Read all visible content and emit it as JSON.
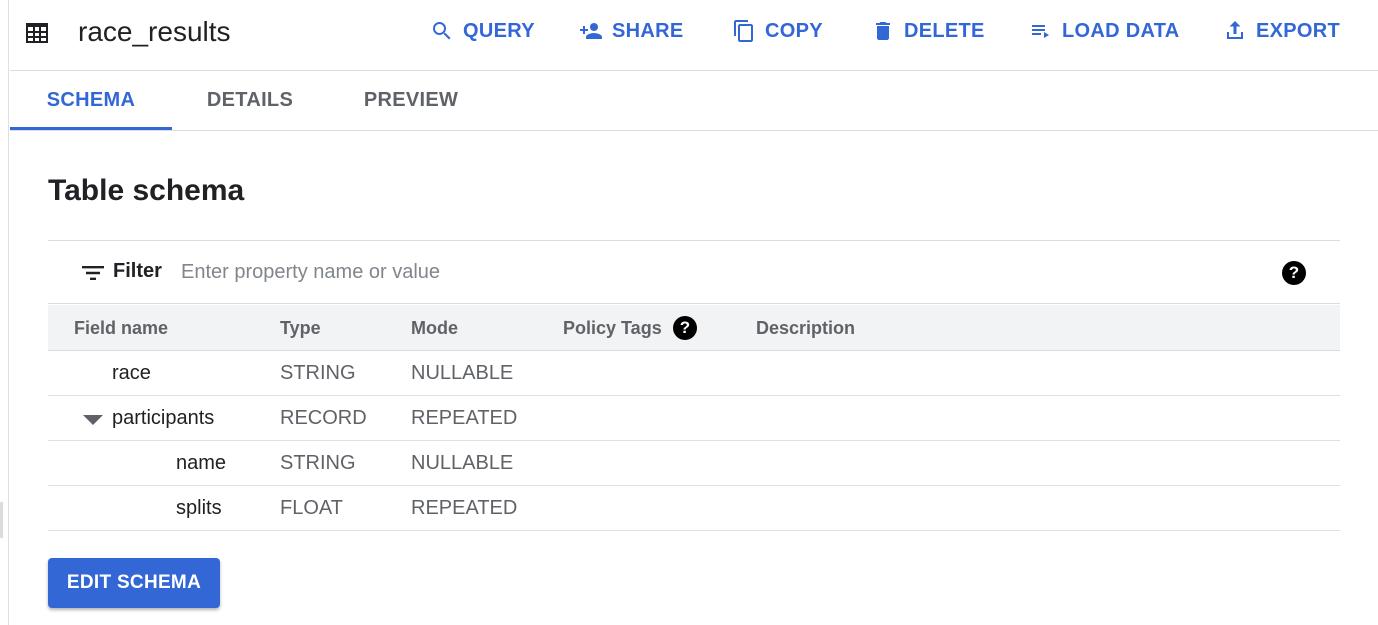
{
  "header": {
    "table_icon": "table-icon",
    "title": "race_results",
    "actions": [
      {
        "label": "QUERY",
        "icon": "search-icon"
      },
      {
        "label": "SHARE",
        "icon": "person-add-icon"
      },
      {
        "label": "COPY",
        "icon": "copy-icon"
      },
      {
        "label": "DELETE",
        "icon": "trash-icon"
      },
      {
        "label": "LOAD DATA",
        "icon": "playlist-add-icon"
      },
      {
        "label": "EXPORT",
        "icon": "upload-icon"
      }
    ]
  },
  "tabs": [
    {
      "label": "SCHEMA",
      "active": true
    },
    {
      "label": "DETAILS",
      "active": false
    },
    {
      "label": "PREVIEW",
      "active": false
    }
  ],
  "section_title": "Table schema",
  "filter": {
    "label": "Filter",
    "placeholder": "Enter property name or value",
    "value": "",
    "help_icon": "?"
  },
  "table": {
    "columns": [
      "Field name",
      "Type",
      "Mode",
      "Policy Tags",
      "Description"
    ],
    "policy_help_icon": "?",
    "rows": [
      {
        "name": "race",
        "type": "STRING",
        "mode": "NULLABLE",
        "policy_tags": "",
        "description": ""
      },
      {
        "name": "participants",
        "type": "RECORD",
        "mode": "REPEATED",
        "policy_tags": "",
        "description": "",
        "expanded": true
      },
      {
        "name": "name",
        "type": "STRING",
        "mode": "NULLABLE",
        "policy_tags": "",
        "description": ""
      },
      {
        "name": "splits",
        "type": "FLOAT",
        "mode": "REPEATED",
        "policy_tags": "",
        "description": ""
      }
    ]
  },
  "edit_button": "EDIT SCHEMA",
  "colors": {
    "accent": "#3367d6",
    "header_bg": "#f1f3f4"
  }
}
